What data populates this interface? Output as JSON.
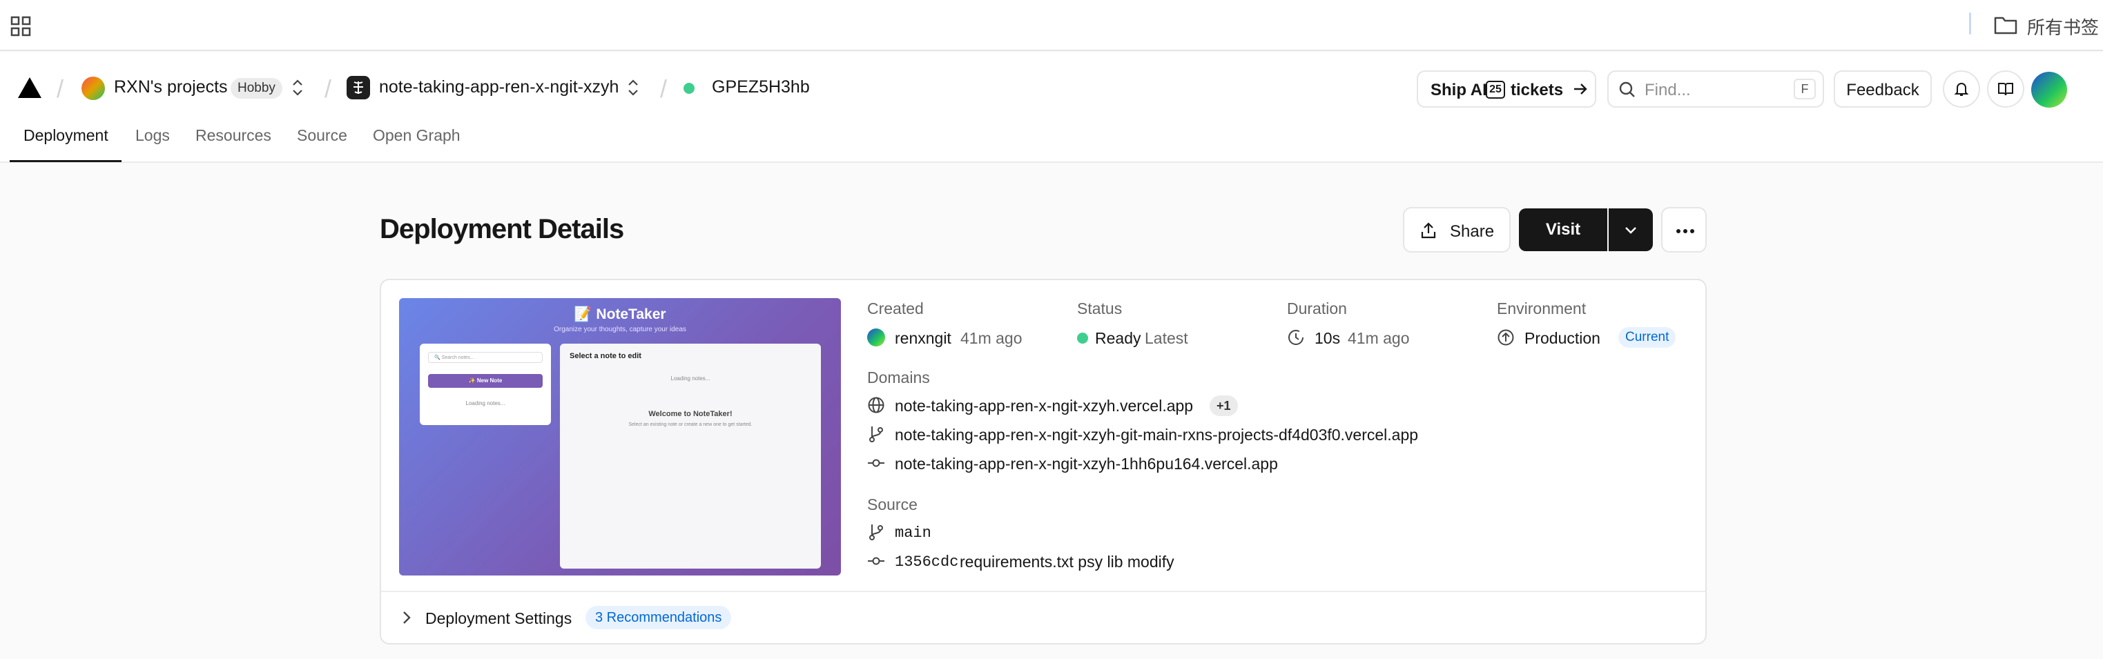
{
  "bookmarks": {
    "label": "所有书签"
  },
  "header": {
    "team_name": "RXN's projects",
    "plan_badge": "Hobby",
    "project_name": "note-taking-app-ren-x-ngit-xzyh",
    "deployment_id": "GPEZ5H3hb",
    "ship": {
      "prefix": "Ship AI",
      "number": "25",
      "suffix": "tickets"
    },
    "find": {
      "placeholder": "Find...",
      "shortcut": "F"
    },
    "feedback_label": "Feedback"
  },
  "tabs": [
    "Deployment",
    "Logs",
    "Resources",
    "Source",
    "Open Graph"
  ],
  "page": {
    "title": "Deployment Details",
    "share_label": "Share",
    "visit_label": "Visit"
  },
  "preview": {
    "title": "📝 NoteTaker",
    "subtitle": "Organize your thoughts, capture your ideas",
    "search_placeholder": "🔍 Search notes...",
    "new_note": "✨ New Note",
    "loading_left": "Loading notes...",
    "select_note": "Select a note to edit",
    "loading_right": "Loading notes...",
    "welcome": "Welcome to NoteTaker!",
    "hint": "Select an existing note or create a new one to get started."
  },
  "details": {
    "created": {
      "label": "Created",
      "user": "renxngit",
      "time": "41m ago"
    },
    "status": {
      "label": "Status",
      "value": "Ready",
      "tag": "Latest"
    },
    "duration": {
      "label": "Duration",
      "value": "10s",
      "time": "41m ago"
    },
    "environment": {
      "label": "Environment",
      "value": "Production",
      "badge": "Current"
    },
    "domains": {
      "label": "Domains",
      "primary": "note-taking-app-ren-x-ngit-xzyh.vercel.app",
      "extra_count": "+1",
      "branch": "note-taking-app-ren-x-ngit-xzyh-git-main-rxns-projects-df4d03f0.vercel.app",
      "commit": "note-taking-app-ren-x-ngit-xzyh-1hh6pu164.vercel.app"
    },
    "source": {
      "label": "Source",
      "branch": "main",
      "commit_hash": "1356cdc",
      "commit_message": "requirements.txt psy lib modify"
    }
  },
  "settings": {
    "label": "Deployment Settings",
    "recommendations": "3 Recommendations"
  }
}
